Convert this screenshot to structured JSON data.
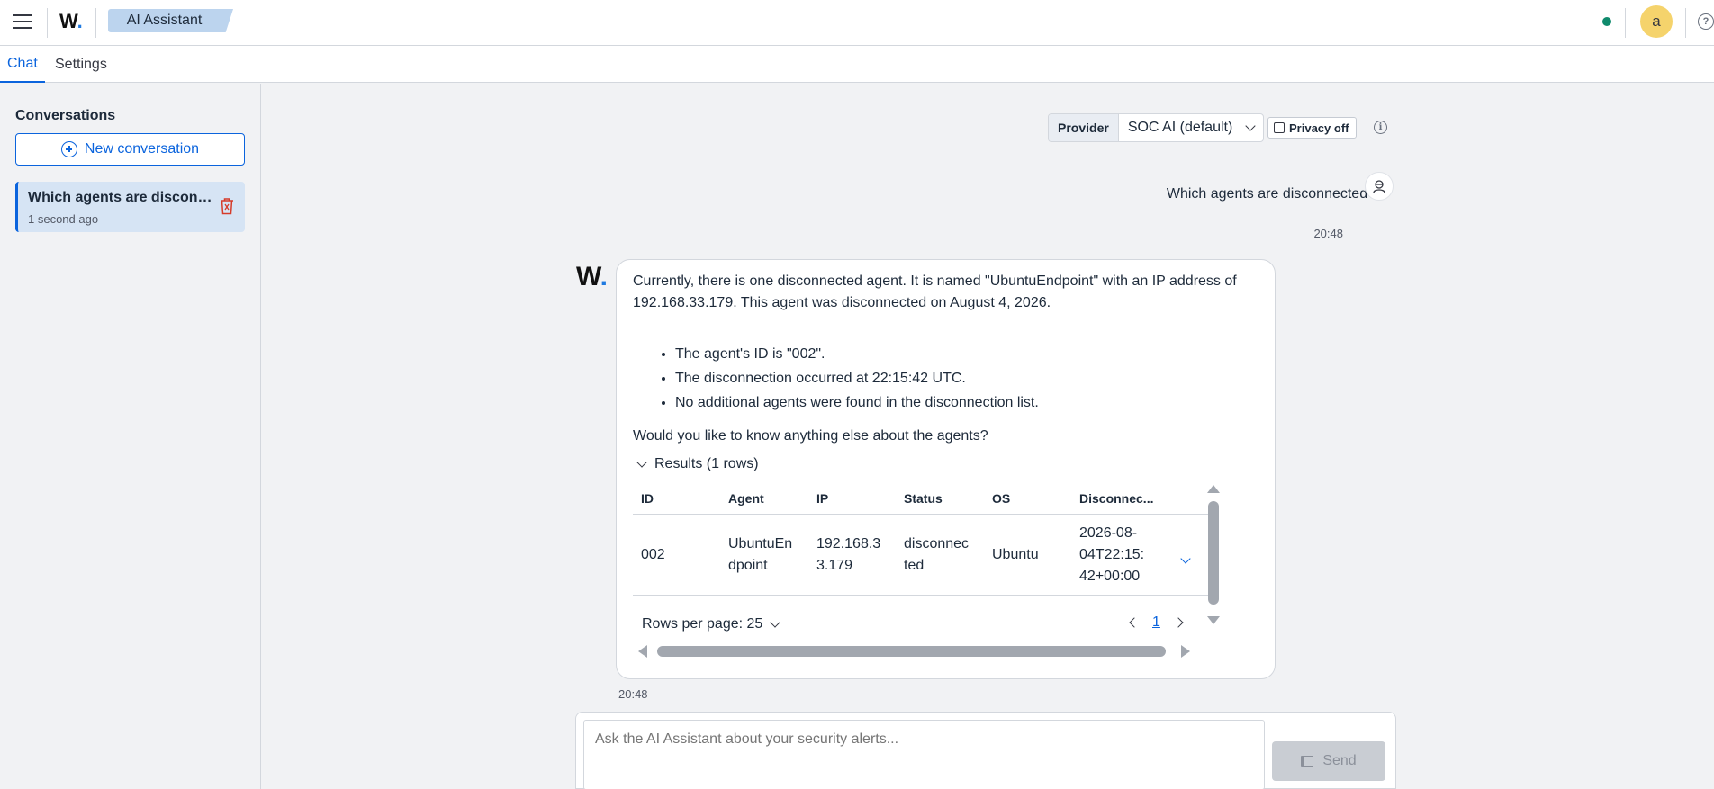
{
  "header": {
    "logo_text": "W",
    "logo_dot": ".",
    "app_title": "AI Assistant",
    "avatar_initial": "a",
    "help_glyph": "?"
  },
  "tabs": [
    {
      "label": "Chat",
      "active": true
    },
    {
      "label": "Settings",
      "active": false
    }
  ],
  "sidebar": {
    "title": "Conversations",
    "new_conversation_label": "New conversation",
    "conversations": [
      {
        "title": "Which agents are disconnected?",
        "time": "1 second ago"
      }
    ]
  },
  "toolbar": {
    "provider_label": "Provider",
    "provider_value": "SOC AI (default)",
    "privacy_label": "Privacy off",
    "info_glyph": "i"
  },
  "messages": {
    "user": {
      "text": "Which agents are disconnected?",
      "time": "20:48"
    },
    "assistant": {
      "logo_text": "W",
      "logo_dot": ".",
      "intro": "Currently, there is one disconnected agent. It is named \"UbuntuEndpoint\" with an IP address of 192.168.33.179. This agent was disconnected on August 4, 2026.",
      "bullets": [
        "The agent's ID is \"002\".",
        "The disconnection occurred at 22:15:42 UTC.",
        "No additional agents were found in the disconnection list."
      ],
      "question": "Would you like to know anything else about the agents?",
      "results_label": "Results (1 rows)",
      "table": {
        "columns": [
          "ID",
          "Agent",
          "IP",
          "Status",
          "OS",
          "Disconnec..."
        ],
        "rows": [
          {
            "id": "002",
            "agent_l1": "UbuntuEn",
            "agent_l2": "dpoint",
            "ip_l1": "192.168.3",
            "ip_l2": "3.179",
            "status_l1": "disconnec",
            "status_l2": "ted",
            "os": "Ubuntu",
            "disc_l1": "2026-08-",
            "disc_l2": "04T22:15:",
            "disc_l3": "42+00:00"
          }
        ]
      },
      "rows_per_page_label": "Rows per page: 25",
      "current_page": "1",
      "time": "20:48"
    }
  },
  "composer": {
    "placeholder": "Ask the AI Assistant about your security alerts...",
    "send_label": "Send"
  },
  "colors": {
    "accent": "#0b64dd",
    "status_online": "#0f8a6c",
    "avatar_bg": "#f5d36c",
    "delete_red": "#d63b2a"
  }
}
